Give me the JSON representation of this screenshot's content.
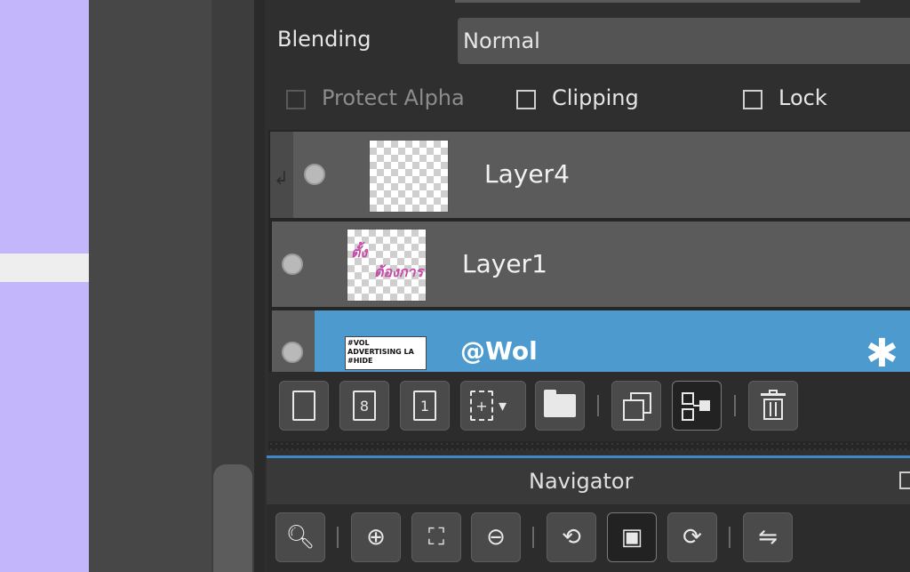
{
  "properties": {
    "blending_label": "Blending",
    "blending_value": "Normal",
    "protect_alpha_label": "Protect Alpha",
    "clipping_label": "Clipping",
    "lock_label": "Lock"
  },
  "layers": [
    {
      "name": "Layer4",
      "selected": false,
      "clipped": true
    },
    {
      "name": "Layer1",
      "selected": false,
      "clipped": false
    },
    {
      "name": "@Wol",
      "selected": true,
      "clipped": false
    }
  ],
  "thumbnails": {
    "layer1_text_a": "ตั้ง",
    "layer1_text_b": "ต้องการ",
    "wol_line1": "#VOL",
    "wol_line2": "ADVERTISING LA",
    "wol_line3": "#HIDE"
  },
  "layer_toolbar": {
    "new_raster_glyph": "",
    "new_8bit_glyph": "8",
    "new_1bit_glyph": "1",
    "more_glyph": "▾"
  },
  "navigator": {
    "title": "Navigator"
  },
  "colors": {
    "selected_row": "#4d9acf",
    "canvas": "#c3b6fb",
    "accent_line": "#3f87c8"
  }
}
